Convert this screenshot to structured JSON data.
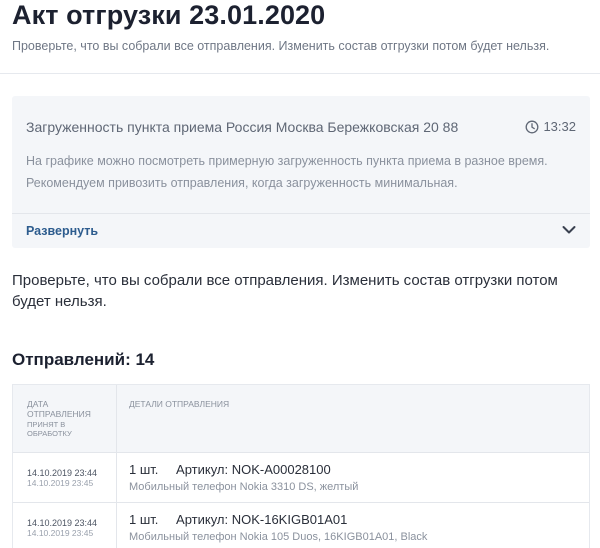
{
  "header": {
    "title": "Акт отгрузки 23.01.2020",
    "subtitle": "Проверьте, что вы собрали все отправления. Изменить состав отгрузки потом будет нельзя."
  },
  "load_panel": {
    "title": "Загруженность пункта приема Россия Москва Бережковская 20 88",
    "time": "13:32",
    "description": "На графике можно посмотреть примерную загруженность пункта приема в разное время. Рекомендуем привозить отправления, когда загруженность минимальная.",
    "expand_label": "Развернуть"
  },
  "notice": "Проверьте, что вы собрали все отправления. Изменить состав отгрузки потом будет нельзя.",
  "shipments": {
    "heading": "Отправлений: 14",
    "columns": {
      "date": "Дата отправления",
      "date_sub": "принят в обработку",
      "details": "Детали отправления"
    },
    "rows": [
      {
        "date": "14.10.2019 23:44",
        "accepted": "14.10.2019 23:45",
        "qty": "1 шт.",
        "article": "Артикул: NOK-A00028100",
        "description": "Мобильный телефон Nokia 3310 DS, желтый"
      },
      {
        "date": "14.10.2019 23:44",
        "accepted": "14.10.2019 23:45",
        "qty": "1 шт.",
        "article": "Артикул: NOK-16KIGB01A01",
        "description": "Мобильный телефон Nokia 105 Duos, 16KIGB01A01, Black"
      }
    ]
  },
  "colors": {
    "link": "#2d5c8e",
    "panel_bg": "#f4f6f9",
    "text_primary": "#1c2130",
    "text_muted": "#8a919d"
  },
  "icons": {
    "clock": "clock-icon",
    "expand": "chevron-down-icon"
  }
}
